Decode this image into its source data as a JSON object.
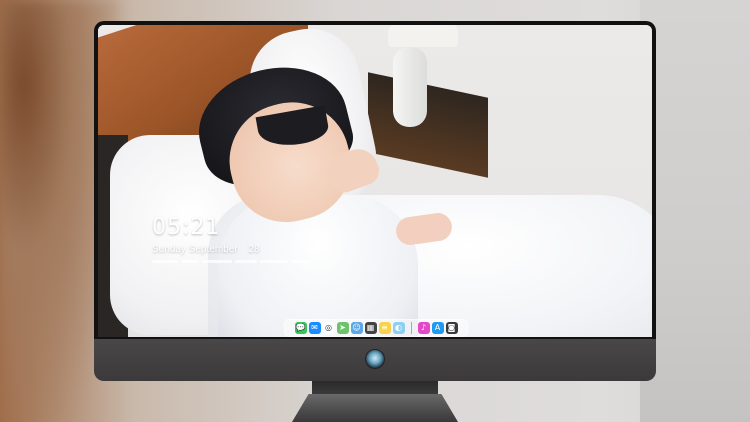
{
  "lock_screen": {
    "time": "05:21",
    "weekday": "Sunday",
    "month": "September",
    "day": "28"
  },
  "dock": {
    "apps": [
      {
        "name": "messages-icon",
        "color": "#34c759",
        "glyph": "💬"
      },
      {
        "name": "mail-icon",
        "color": "#1a8cff",
        "glyph": "✉"
      },
      {
        "name": "safari-icon",
        "color": "#ffffff",
        "glyph": "◎"
      },
      {
        "name": "maps-icon",
        "color": "#6cc36a",
        "glyph": "➤"
      },
      {
        "name": "finder-icon",
        "color": "#5fa8e8",
        "glyph": "☺"
      },
      {
        "name": "clapper-icon",
        "color": "#444444",
        "glyph": "▦"
      },
      {
        "name": "notes-icon",
        "color": "#f7d24a",
        "glyph": "≡"
      },
      {
        "name": "photos-icon",
        "color": "#8ed0f3",
        "glyph": "◐"
      }
    ],
    "apps_right": [
      {
        "name": "itunes-icon",
        "color": "#e547c9",
        "glyph": "♪"
      },
      {
        "name": "app-store-icon",
        "color": "#1e9af0",
        "glyph": "A"
      },
      {
        "name": "camera-icon",
        "color": "#3a3a3a",
        "glyph": "◙"
      }
    ]
  },
  "colors": {
    "monitor_bezel": "#111111",
    "monitor_chin": "#403e3f",
    "dock_background": "rgba(255,255,255,0.45)"
  }
}
